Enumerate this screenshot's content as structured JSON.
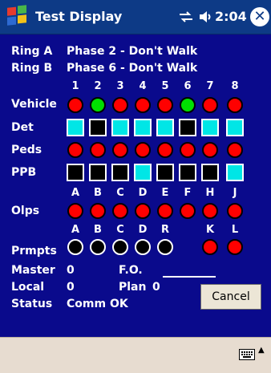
{
  "titlebar": {
    "title": "Test Display",
    "time": "2:04"
  },
  "rings": [
    {
      "label": "Ring A",
      "value": "Phase 2 - Don't Walk"
    },
    {
      "label": "Ring B",
      "value": "Phase 6 - Don't Walk"
    }
  ],
  "phase_numbers": [
    "1",
    "2",
    "3",
    "4",
    "5",
    "6",
    "7",
    "8"
  ],
  "rows": {
    "vehicle": {
      "label": "Vehicle",
      "states": [
        "red",
        "green",
        "red",
        "red",
        "red",
        "green",
        "red",
        "red"
      ]
    },
    "det": {
      "label": "Det",
      "states": [
        "cyan",
        "black",
        "cyan",
        "cyan",
        "cyan",
        "black",
        "cyan",
        "cyan"
      ]
    },
    "peds": {
      "label": "Peds",
      "states": [
        "red",
        "red",
        "red",
        "red",
        "red",
        "red",
        "red",
        "red"
      ]
    },
    "ppb": {
      "label": "PPB",
      "states": [
        "black",
        "black",
        "black",
        "cyan",
        "black",
        "black",
        "black",
        "cyan"
      ]
    },
    "olps": {
      "label": "Olps",
      "letters": [
        "A",
        "B",
        "C",
        "D",
        "E",
        "F",
        "H",
        "J"
      ],
      "states": [
        "red",
        "red",
        "red",
        "red",
        "red",
        "red",
        "red",
        "red"
      ]
    },
    "prmpts": {
      "label": "Prmpts",
      "letters": [
        "A",
        "B",
        "C",
        "D",
        "R",
        "",
        "K",
        "L"
      ],
      "states": [
        "black",
        "black",
        "black",
        "black",
        "black",
        "none",
        "red",
        "red"
      ]
    }
  },
  "status": {
    "master_label": "Master",
    "master_value": "0",
    "fo_label": "F.O.",
    "local_label": "Local",
    "local_value": "0",
    "plan_label": "Plan",
    "plan_value": "0",
    "status_label": "Status",
    "status_value": "Comm OK"
  },
  "buttons": {
    "cancel": "Cancel"
  },
  "colors": {
    "background": "#0a0a8c",
    "titlebar": "#0d3a86",
    "red": "#ff0000",
    "green": "#00e000",
    "cyan": "#00e6e6",
    "black": "#000000",
    "bottombar": "#e7dcd0"
  }
}
